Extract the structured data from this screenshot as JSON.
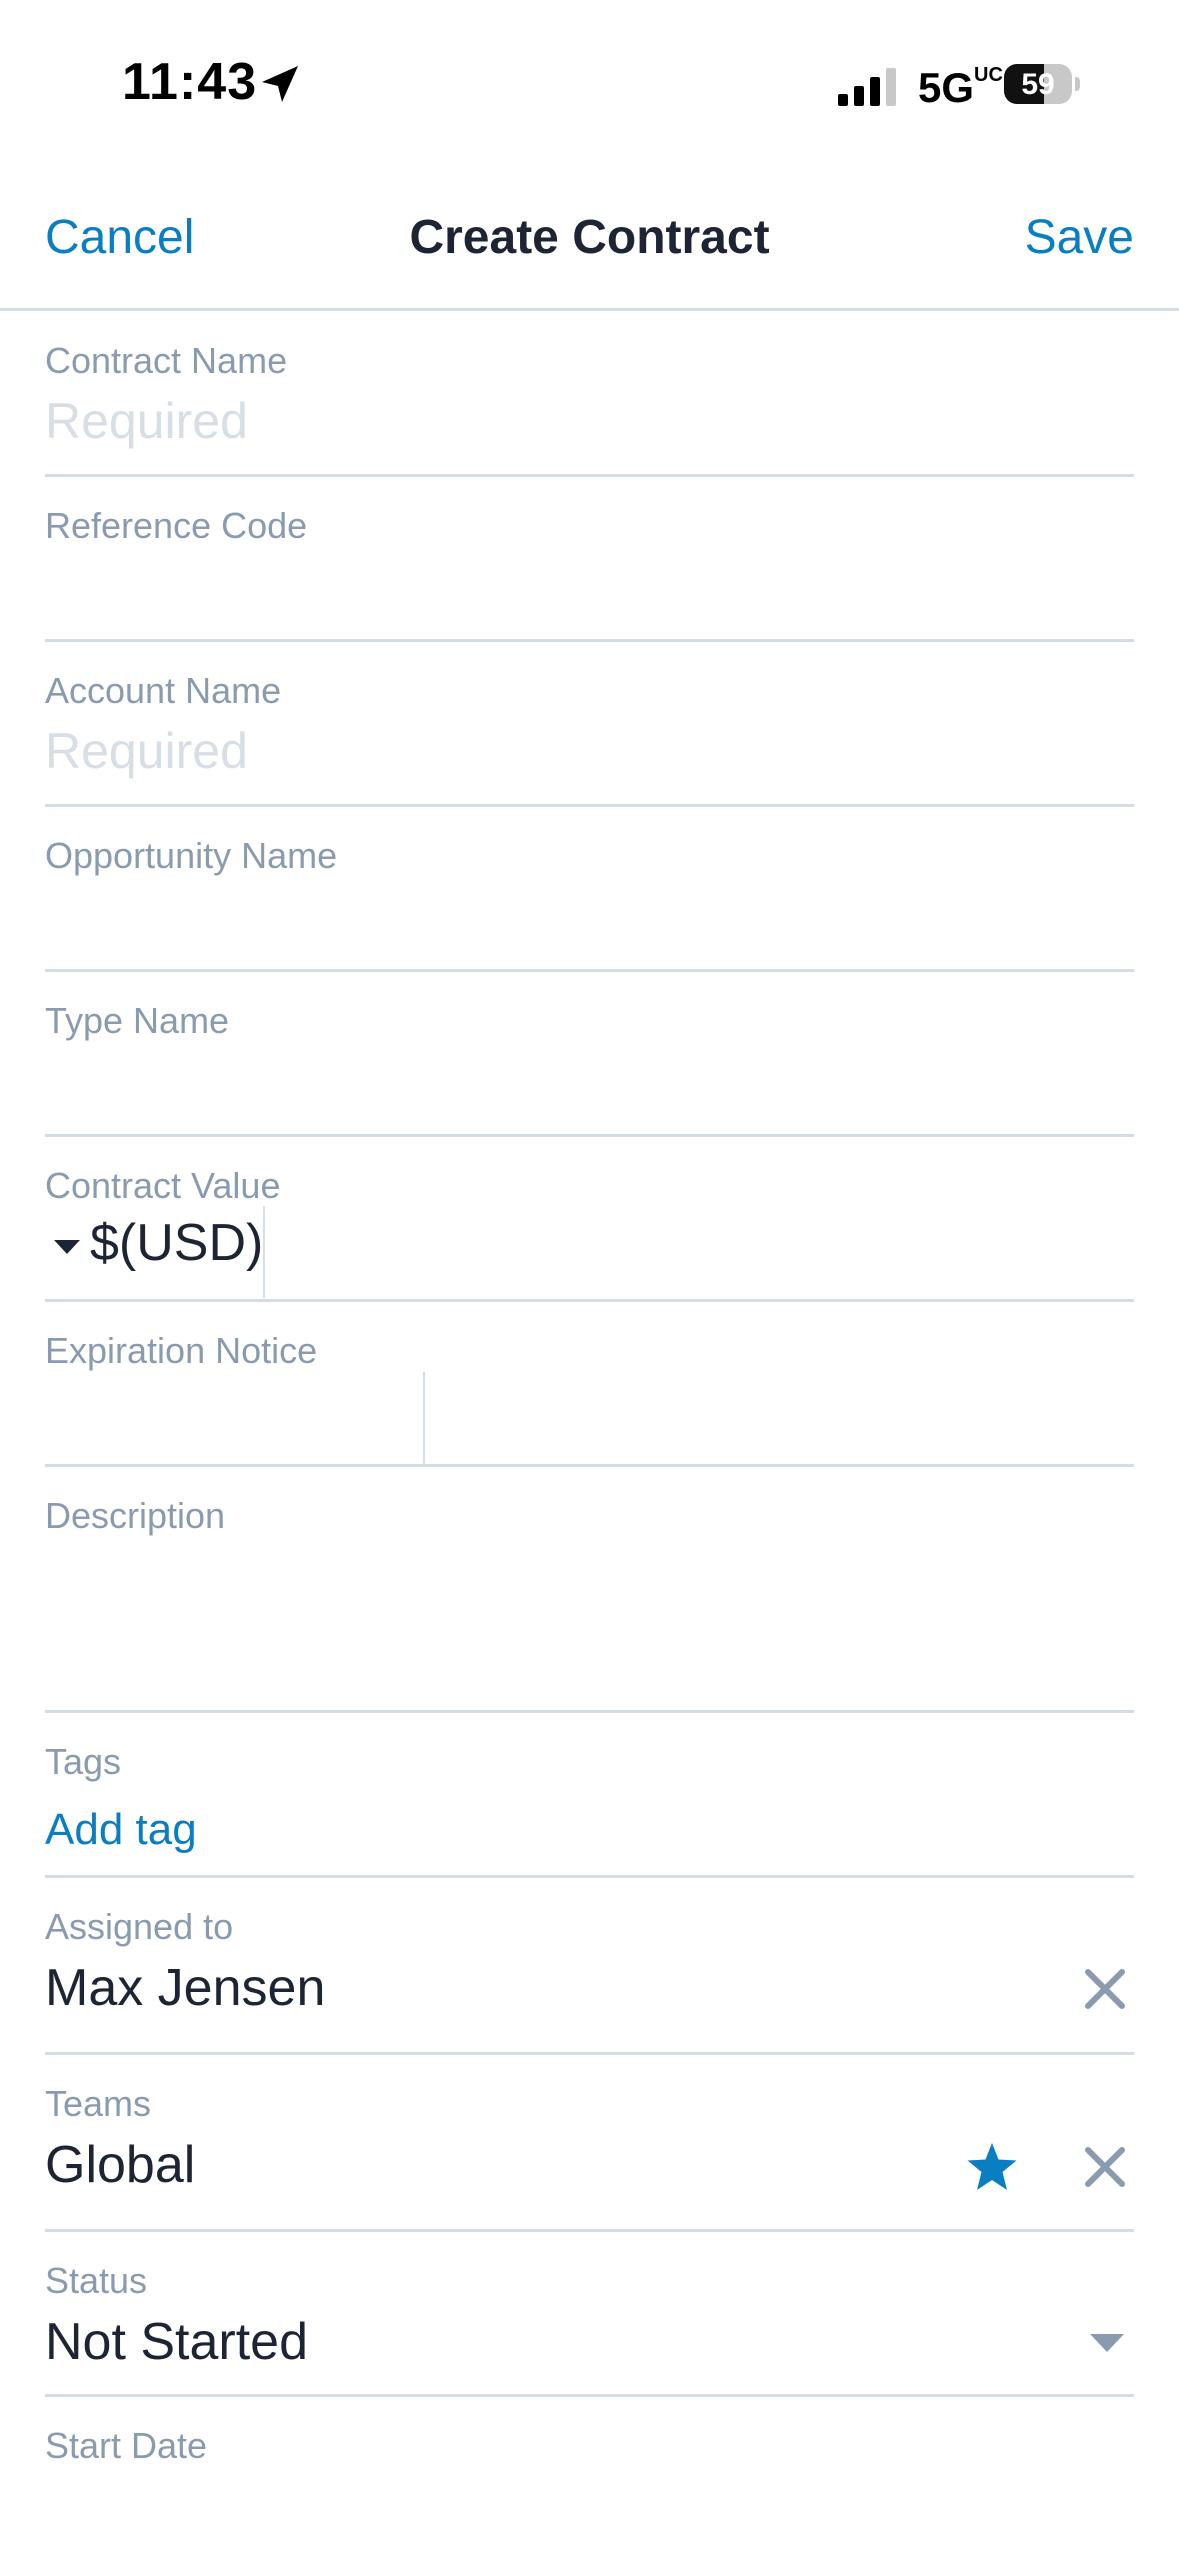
{
  "status_bar": {
    "time": "11:43",
    "network": "5G",
    "network_suffix": "UC",
    "battery": "59"
  },
  "nav": {
    "cancel_label": "Cancel",
    "title": "Create Contract",
    "save_label": "Save"
  },
  "form": {
    "contract_name": {
      "label": "Contract Name",
      "placeholder": "Required"
    },
    "reference_code": {
      "label": "Reference Code",
      "value": ""
    },
    "account_name": {
      "label": "Account Name",
      "placeholder": "Required"
    },
    "opportunity_name": {
      "label": "Opportunity Name",
      "value": ""
    },
    "type_name": {
      "label": "Type Name",
      "value": ""
    },
    "contract_value": {
      "label": "Contract Value",
      "currency": "$(USD)"
    },
    "expiration_notice": {
      "label": "Expiration Notice"
    },
    "description": {
      "label": "Description"
    },
    "tags": {
      "label": "Tags",
      "add_label": "Add tag"
    },
    "assigned_to": {
      "label": "Assigned to",
      "value": "Max Jensen"
    },
    "teams": {
      "label": "Teams",
      "value": "Global"
    },
    "status": {
      "label": "Status",
      "value": "Not Started"
    },
    "start_date": {
      "label": "Start Date"
    }
  },
  "colors": {
    "accent": "#0a7ec2",
    "label": "#8a9bb0",
    "divider": "#d4dde6",
    "text": "#1d2433"
  }
}
